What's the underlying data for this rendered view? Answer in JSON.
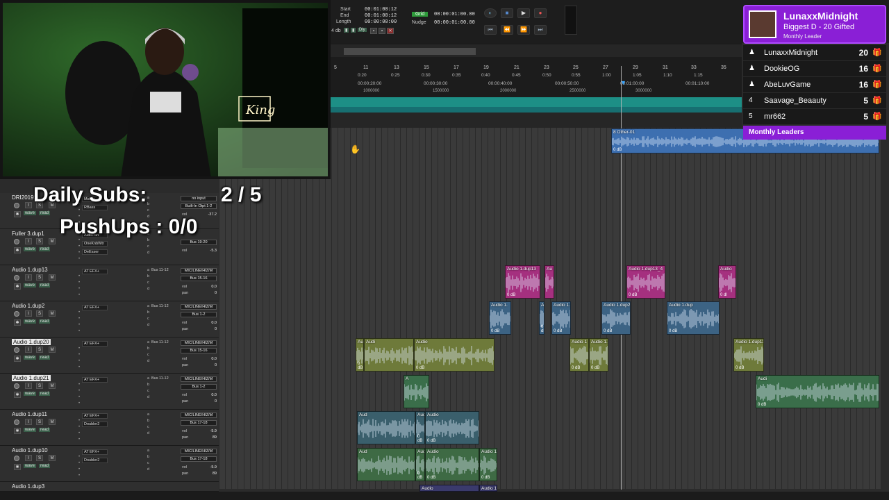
{
  "transport": {
    "start_label": "Start",
    "start_value": "00:01:00:12",
    "end_label": "End",
    "end_value": "00:01:00:12",
    "length_label": "Length",
    "length_value": "00:00:00:00",
    "grid_label": "Grid",
    "grid_value": "00:00:01:00.00",
    "nudge_label": "Nudge",
    "nudge_value": "00:00:01:00.00",
    "db_label": "4 db",
    "dly_label": "Dly"
  },
  "ruler": {
    "bars": [
      "5",
      "11",
      "13",
      "15",
      "17",
      "19",
      "21",
      "23",
      "25",
      "27",
      "29",
      "31",
      "33",
      "35"
    ],
    "mins": [
      "0:20",
      "0:25",
      "0:30",
      "0:35",
      "0:40",
      "0:45",
      "0:50",
      "0:55",
      "1:00",
      "1:05",
      "1:10",
      "1:15"
    ],
    "timecodes": [
      "00:00:20:00",
      "00:00:30:00",
      "00:00:40:00",
      "00:00:50:00",
      "00:01:00:00",
      "00:01:10:00"
    ],
    "samples": [
      "1000000",
      "1500000",
      "2000000",
      "2500000",
      "3000000"
    ]
  },
  "overlay": {
    "daily_subs_label": "Daily Subs:",
    "daily_subs_value": "2 / 5",
    "pushups": "PushUps : 0/0"
  },
  "leaderboard": {
    "top_name": "LunaxxMidnight",
    "top_sub": "Biggest D - 20 Gifted",
    "top_caption": "Monthly Leader",
    "rows": [
      {
        "rank": "♟",
        "name": "LunaxxMidnight",
        "count": "20"
      },
      {
        "rank": "♟",
        "name": "DookieOG",
        "count": "16"
      },
      {
        "rank": "♟",
        "name": "AbeLuvGame",
        "count": "16"
      },
      {
        "rank": "4",
        "name": "Saavage_Beaauty",
        "count": "5"
      },
      {
        "rank": "5",
        "name": "mr662",
        "count": "5"
      }
    ],
    "footer": "Monthly Leaders"
  },
  "tracks": [
    {
      "name": "DRI20191",
      "sel": false,
      "insert": "Maxim",
      "insert2": "RBass",
      "io_in": "no input",
      "io_out": "Built-In Otpt 1-2",
      "vol": "-37.2",
      "pan": "",
      "mode": "wave"
    },
    {
      "name": "Fuller 3.dup1",
      "sel": false,
      "insert": "AutoPan",
      "insert2": "OneKnbWtr",
      "insert3": "DeEsser",
      "io_in": "",
      "io_out": "Bus 19-20",
      "vol": "-5.3",
      "pan": "",
      "mode": "wave"
    },
    {
      "name": "Audio 1.dup13",
      "sel": false,
      "insert": "AT EFX+",
      "io_in": "MIC/LINE/HIZ/M",
      "send": "Bus 11-12",
      "io_out": "Bus 15-16",
      "vol": "0.0",
      "pan": "0",
      "mode": "wave"
    },
    {
      "name": "Audio 1.dup2",
      "sel": false,
      "insert": "AT EFX+",
      "io_in": "MIC/LINE/HIZ/M",
      "send": "Bus 11-12",
      "io_out": "Bus 1-2",
      "vol": "0.0",
      "pan": "0",
      "mode": "wave"
    },
    {
      "name": "Audio 1.dup20",
      "sel": true,
      "insert": "AT EFX+",
      "io_in": "MIC/LINE/HIZ/M",
      "send": "Bus 11-12",
      "io_out": "Bus 15-16",
      "vol": "0.0",
      "pan": "0",
      "mode": "wave"
    },
    {
      "name": "Audio 1.dup21",
      "sel": true,
      "insert": "AT EFX+",
      "io_in": "MIC/LINE/HIZ/M",
      "send": "Bus 11-12",
      "io_out": "Bus 1-2",
      "vol": "0.0",
      "pan": "0",
      "mode": "wave"
    },
    {
      "name": "Audio 1.dup11",
      "sel": false,
      "insert": "AT EFX+",
      "insert2": "Doubler2",
      "io_in": "MIC/LINE/HIZ/M",
      "send": "",
      "io_out": "Bus 17-18",
      "vol": "-5.9",
      "pan": "89",
      "mode": "wave"
    },
    {
      "name": "Audio 1.dup10",
      "sel": false,
      "insert": "AT EFX+",
      "insert2": "Doubler2",
      "io_in": "MIC/LINE/HIZ/M",
      "send": "",
      "io_out": "Bus 17-18",
      "vol": "-5.9",
      "pan": "89",
      "mode": "wave"
    },
    {
      "name": "Audio 1.dup3",
      "sel": false,
      "insert": "AT EFX+",
      "io_in": "MIC/LINE/HIZ/M",
      "send": "",
      "io_out": "",
      "vol": "",
      "pan": "",
      "mode": "wave"
    }
  ],
  "clips": [
    {
      "name": "8 Other-01",
      "db": "0 dB",
      "color": "#3d6fb0",
      "lane": -1
    },
    {
      "name": "Audio 1.dup13",
      "db": "0 dB",
      "color": "#a5307f",
      "lane": 2
    },
    {
      "name": "Au",
      "db": "",
      "color": "#a5307f",
      "lane": 2
    },
    {
      "name": "Audio 1.dup13_4",
      "db": "0 dB",
      "color": "#a5307f",
      "lane": 2
    },
    {
      "name": "Audio",
      "db": "0 dl",
      "color": "#a5307f",
      "lane": 2
    },
    {
      "name": "Audio 1.",
      "db": "0 dB",
      "color": "#3c6384",
      "lane": 3
    },
    {
      "name": "Audio",
      "db": "0 dB",
      "color": "#3c6384",
      "lane": 3
    },
    {
      "name": "Audio 1.dup",
      "db": "0 dB",
      "color": "#3c6384",
      "lane": 3
    },
    {
      "name": "Audio 1.dup2_74-01",
      "db": "0 dB",
      "color": "#3c6384",
      "lane": 3
    },
    {
      "name": "Audio 1.dup",
      "db": "0 dB",
      "color": "#3c6384",
      "lane": 3
    },
    {
      "name": "Audio 1.dup13_33-04",
      "db": "0 dB",
      "color": "#6e7a3a",
      "lane": 4
    },
    {
      "name": "Audio 1.dup13_33-05",
      "db": "0 dB",
      "color": "#6e7a3a",
      "lane": 4
    },
    {
      "name": "Audi",
      "db": "",
      "color": "#6e7a3a",
      "lane": 4
    },
    {
      "name": "Audio",
      "db": "0 dB",
      "color": "#6e7a3a",
      "lane": 4
    },
    {
      "name": "Audio 1",
      "db": "0 dB",
      "color": "#6e7a3a",
      "lane": 4
    },
    {
      "name": "Audio 1.dup20_29-01",
      "db": "0 dB",
      "color": "#6e7a3a",
      "lane": 4
    },
    {
      "name": "Audi",
      "db": "0 dB",
      "color": "#3a6e4a",
      "lane": 5
    },
    {
      "name": "A",
      "db": "",
      "color": "#3a6e4a",
      "lane": 5
    },
    {
      "name": "Audio 1.dup11_68-02",
      "db": "0 dB",
      "color": "#3a5f6c",
      "lane": 6
    },
    {
      "name": "Aud",
      "db": "",
      "color": "#3a5f6c",
      "lane": 6
    },
    {
      "name": "Audio 1.dup11_03-02",
      "db": "0 dB",
      "color": "#3a5f6c",
      "lane": 6
    },
    {
      "name": "Audio",
      "db": "0 dB",
      "color": "#3a5f6c",
      "lane": 6
    },
    {
      "name": "Audio 1.dup11_67-02",
      "db": "0 dB",
      "color": "#3e6a44",
      "lane": 7
    },
    {
      "name": "Aud",
      "db": "",
      "color": "#3e6a44",
      "lane": 7
    },
    {
      "name": "Audio 1.dup10_44-02",
      "db": "0 dB",
      "color": "#3e6a44",
      "lane": 7
    },
    {
      "name": "Audio",
      "db": "0 dB",
      "color": "#3e6a44",
      "lane": 7
    },
    {
      "name": "Audio 1.dup3_33-02",
      "db": "",
      "color": "#3a3a6c",
      "lane": 8
    },
    {
      "name": "Audio",
      "db": "",
      "color": "#3a3a6c",
      "lane": 8
    }
  ],
  "webcam": {
    "neon_sign": "King"
  }
}
